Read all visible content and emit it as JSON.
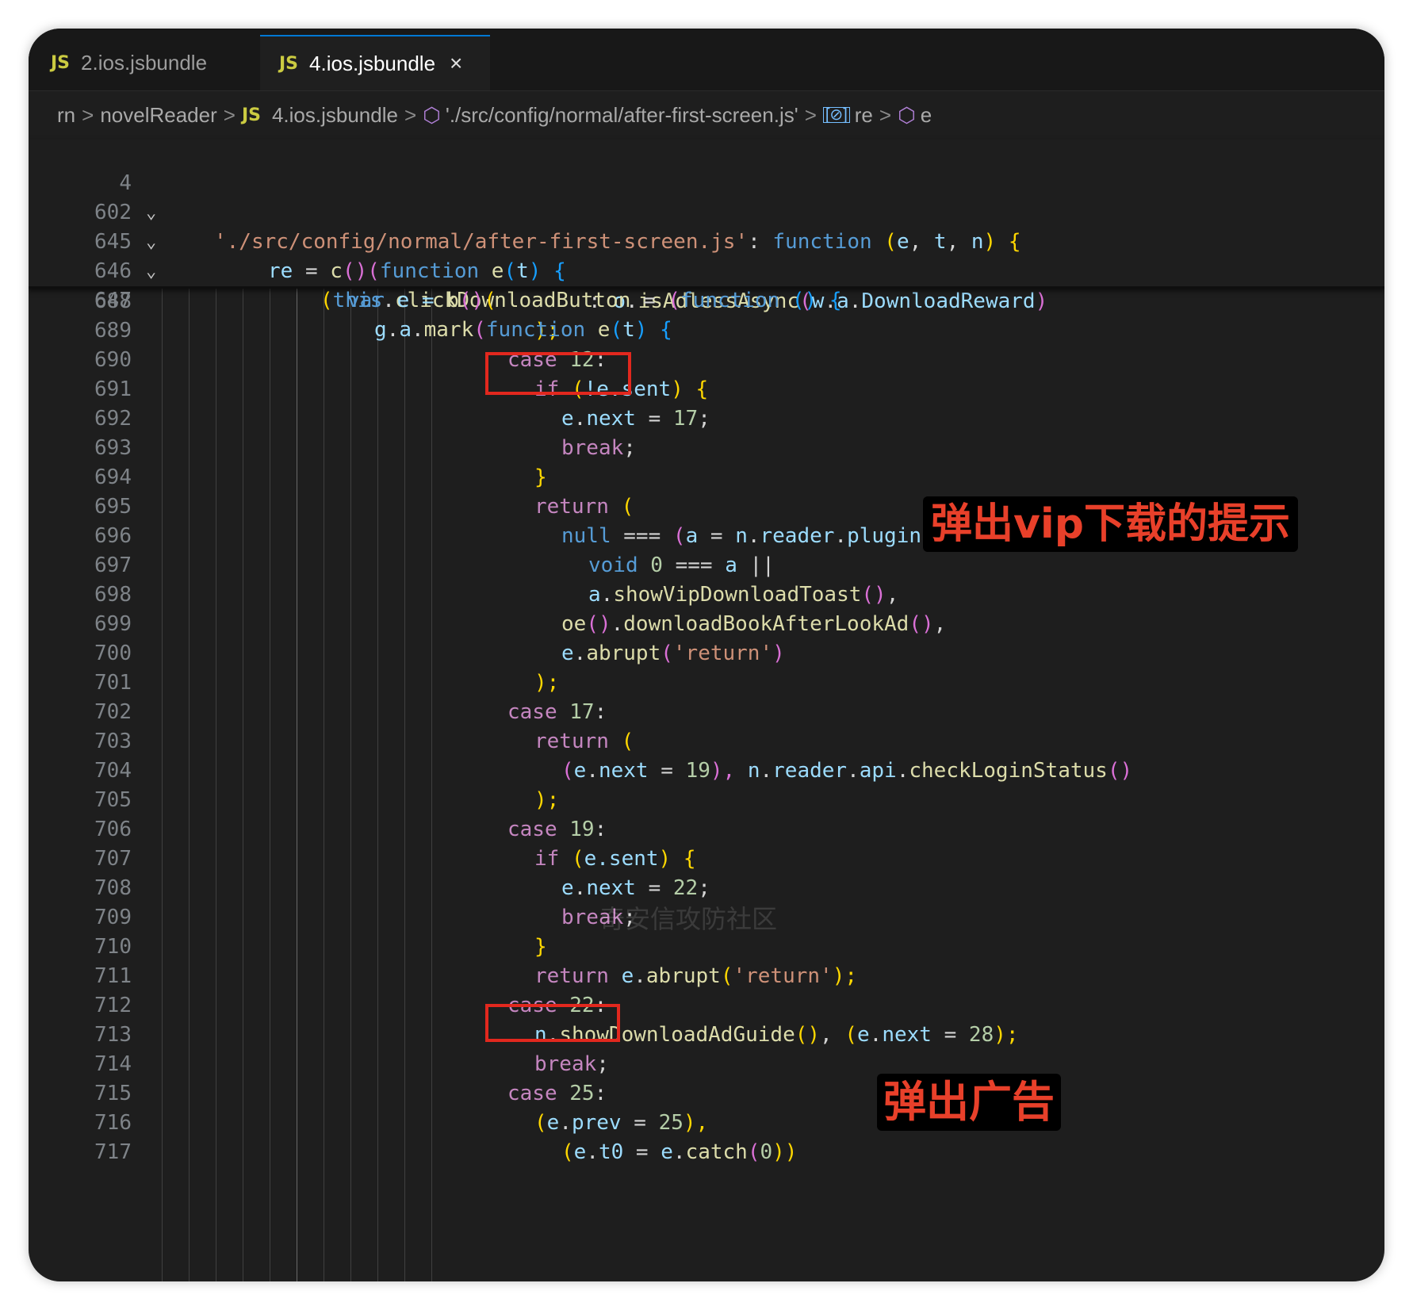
{
  "tabs": [
    {
      "icon": "JS",
      "label": "2.ios.jsbundle"
    },
    {
      "icon": "JS",
      "label": "4.ios.jsbundle",
      "close": "×"
    }
  ],
  "breadcrumb": {
    "items": [
      "rn",
      "novelReader",
      "4.ios.jsbundle",
      "'./src/config/normal/after-first-screen.js'",
      "re",
      "e"
    ],
    "js_icon": "JS",
    "module_icon": "⬡",
    "variable_icon": "[⊘]",
    "separator": ">"
  },
  "sticky_lines": [
    {
      "ln": "4",
      "fold": "⌄"
    },
    {
      "ln": "602",
      "fold": "⌄"
    },
    {
      "ln": "645",
      "fold": "⌄"
    },
    {
      "ln": "646",
      "fold": ""
    },
    {
      "ln": "647",
      "fold": ""
    }
  ],
  "line_numbers": [
    "688",
    "689",
    "690",
    "691",
    "692",
    "693",
    "694",
    "695",
    "696",
    "697",
    "698",
    "699",
    "700",
    "701",
    "702",
    "703",
    "704",
    "705",
    "706",
    "707",
    "708",
    "709",
    "710",
    "711",
    "712",
    "713",
    "714",
    "715",
    "716",
    "717"
  ],
  "code": {
    "s4": [
      "'./src/config/normal/after-first-screen.js'",
      ": ",
      "function",
      " (",
      "e",
      ", ",
      "t",
      ", ",
      "n",
      ") ",
      "{"
    ],
    "s602": [
      "re",
      " = ",
      "c",
      "()",
      "(",
      "function",
      " ",
      "e",
      "(",
      "t",
      ") ",
      "{"
    ],
    "s645": [
      "(",
      "this",
      ".",
      "clickDownloadButton",
      " = ",
      "(",
      "function",
      " () ",
      "{"
    ],
    "s646": [
      "var",
      " e = ",
      "b",
      "()",
      "("
    ],
    "s647": [
      "g",
      ".",
      "a",
      ".",
      "mark",
      "(",
      "function",
      " ",
      "e",
      "(",
      "t",
      ") ",
      "{"
    ],
    "l688": [
      ": ",
      "o",
      ".",
      "isAdlessAsync",
      "(",
      "w",
      ".",
      "a",
      ".",
      "DownloadReward",
      ")"
    ],
    "l689": [
      ");"
    ],
    "l690": [
      "case",
      " ",
      "12",
      ":"
    ],
    "l691": [
      "if",
      " (",
      "!e.sent",
      ") ",
      "{"
    ],
    "l692": [
      "e",
      ".",
      "next",
      " = ",
      "17",
      ";"
    ],
    "l693": [
      "break",
      ";"
    ],
    "l694": [
      "}"
    ],
    "l695": [
      "return",
      " ("
    ],
    "l696": [
      "null",
      " === ",
      "(",
      "a",
      " = ",
      "n",
      ".",
      "reader",
      ".",
      "plugin",
      ".",
      "vip",
      ") ",
      "||"
    ],
    "l697": [
      "void",
      " ",
      "0",
      " === ",
      "a",
      " ||"
    ],
    "l698": [
      "a",
      ".",
      "showVipDownloadToast",
      "()",
      ","
    ],
    "l699": [
      "oe",
      "()",
      ".",
      "downloadBookAfterLookAd",
      "()",
      ","
    ],
    "l700": [
      "e",
      ".",
      "abrupt",
      "(",
      "'return'",
      ")"
    ],
    "l701": [
      ");"
    ],
    "l702": [
      "case",
      " ",
      "17",
      ":"
    ],
    "l703": [
      "return",
      " ("
    ],
    "l704": [
      "(",
      "e",
      ".",
      "next",
      " = ",
      "19",
      "), ",
      "n",
      ".",
      "reader",
      ".",
      "api",
      ".",
      "checkLoginStatus",
      "()"
    ],
    "l705": [
      ");"
    ],
    "l706": [
      "case",
      " ",
      "19",
      ":"
    ],
    "l707": [
      "if",
      " (",
      "e.sent",
      ") ",
      "{"
    ],
    "l708": [
      "e",
      ".",
      "next",
      " = ",
      "22",
      ";"
    ],
    "l709": [
      "break",
      ";"
    ],
    "l710": [
      "}"
    ],
    "l711": [
      "return",
      " ",
      "e",
      ".",
      "abrupt",
      "(",
      "'return'",
      ");"
    ],
    "l712": [
      "case",
      " ",
      "22",
      ":"
    ],
    "l713": [
      "n",
      ".",
      "showDownloadAdGuide",
      "()",
      ", ",
      "(",
      "e",
      ".",
      "next",
      " = ",
      "28",
      ");"
    ],
    "l714": [
      "break",
      ";"
    ],
    "l715": [
      "case",
      " ",
      "25",
      ":"
    ],
    "l716": [
      "(",
      "e",
      ".",
      "prev",
      " = ",
      "25",
      "),"
    ],
    "l717": [
      "(",
      "e",
      ".",
      "t0",
      " = ",
      "e",
      ".",
      "catch",
      "(",
      "0",
      "))"
    ]
  },
  "annotations": {
    "vip_prompt": "弹出vip下载的提示",
    "ad_popup": "弹出广告"
  },
  "watermark": "奇安信攻防社区",
  "colors": {
    "annotation_red": "#e2281e",
    "tab_accent": "#0078d4"
  }
}
